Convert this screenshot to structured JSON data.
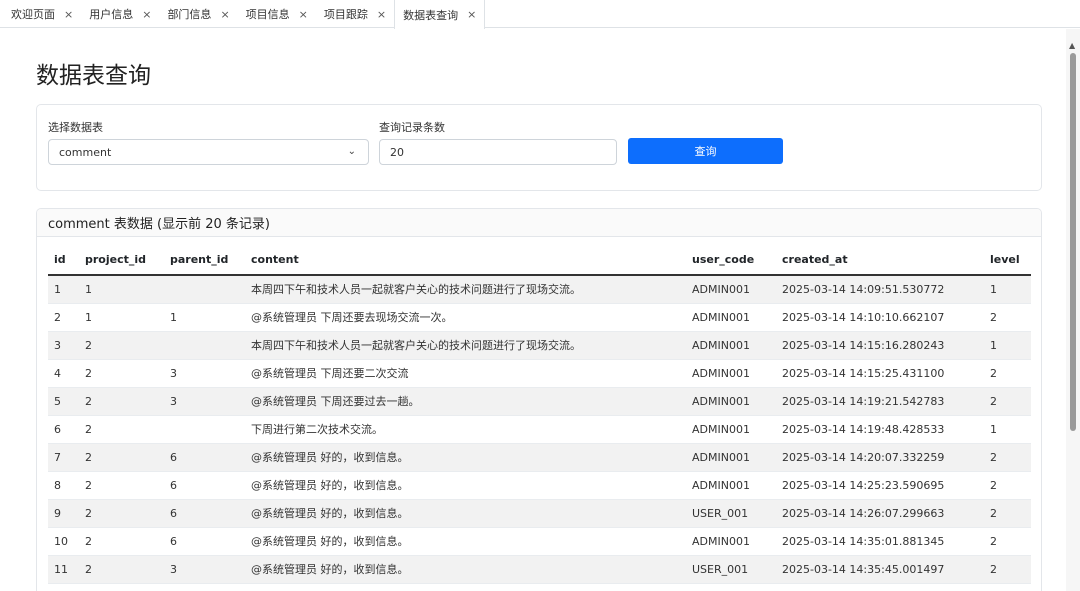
{
  "tabs": [
    {
      "label": "欢迎页面",
      "close": "×"
    },
    {
      "label": "用户信息",
      "close": "×"
    },
    {
      "label": "部门信息",
      "close": "×"
    },
    {
      "label": "项目信息",
      "close": "×"
    },
    {
      "label": "项目跟踪",
      "close": "×"
    },
    {
      "label": "数据表查询",
      "close": "×",
      "active": true
    }
  ],
  "page": {
    "title": "数据表查询"
  },
  "form": {
    "table_label": "选择数据表",
    "table_value": "comment",
    "count_label": "查询记录条数",
    "count_value": "20",
    "query_button": "查询"
  },
  "results": {
    "header": "comment 表数据 (显示前 20 条记录)",
    "columns": [
      "id",
      "project_id",
      "parent_id",
      "content",
      "user_code",
      "created_at",
      "level"
    ],
    "rows": [
      [
        "1",
        "1",
        "",
        "本周四下午和技术人员一起就客户关心的技术问题进行了现场交流。",
        "ADMIN001",
        "2025-03-14 14:09:51.530772",
        "1"
      ],
      [
        "2",
        "1",
        "1",
        "@系统管理员 下周还要去现场交流一次。",
        "ADMIN001",
        "2025-03-14 14:10:10.662107",
        "2"
      ],
      [
        "3",
        "2",
        "",
        "本周四下午和技术人员一起就客户关心的技术问题进行了现场交流。",
        "ADMIN001",
        "2025-03-14 14:15:16.280243",
        "1"
      ],
      [
        "4",
        "2",
        "3",
        "@系统管理员 下周还要二次交流",
        "ADMIN001",
        "2025-03-14 14:15:25.431100",
        "2"
      ],
      [
        "5",
        "2",
        "3",
        "@系统管理员 下周还要过去一趟。",
        "ADMIN001",
        "2025-03-14 14:19:21.542783",
        "2"
      ],
      [
        "6",
        "2",
        "",
        "下周进行第二次技术交流。",
        "ADMIN001",
        "2025-03-14 14:19:48.428533",
        "1"
      ],
      [
        "7",
        "2",
        "6",
        "@系统管理员 好的，收到信息。",
        "ADMIN001",
        "2025-03-14 14:20:07.332259",
        "2"
      ],
      [
        "8",
        "2",
        "6",
        "@系统管理员 好的，收到信息。",
        "ADMIN001",
        "2025-03-14 14:25:23.590695",
        "2"
      ],
      [
        "9",
        "2",
        "6",
        "@系统管理员 好的，收到信息。",
        "USER_001",
        "2025-03-14 14:26:07.299663",
        "2"
      ],
      [
        "10",
        "2",
        "6",
        "@系统管理员 好的，收到信息。",
        "ADMIN001",
        "2025-03-14 14:35:01.881345",
        "2"
      ],
      [
        "11",
        "2",
        "3",
        "@系统管理员 好的，收到信息。",
        "USER_001",
        "2025-03-14 14:35:45.001497",
        "2"
      ]
    ]
  },
  "icons": {
    "tab_close": "close-icon",
    "select_chevron": "chevron-down-icon",
    "scroll_up": "scroll-up-arrow-icon"
  }
}
